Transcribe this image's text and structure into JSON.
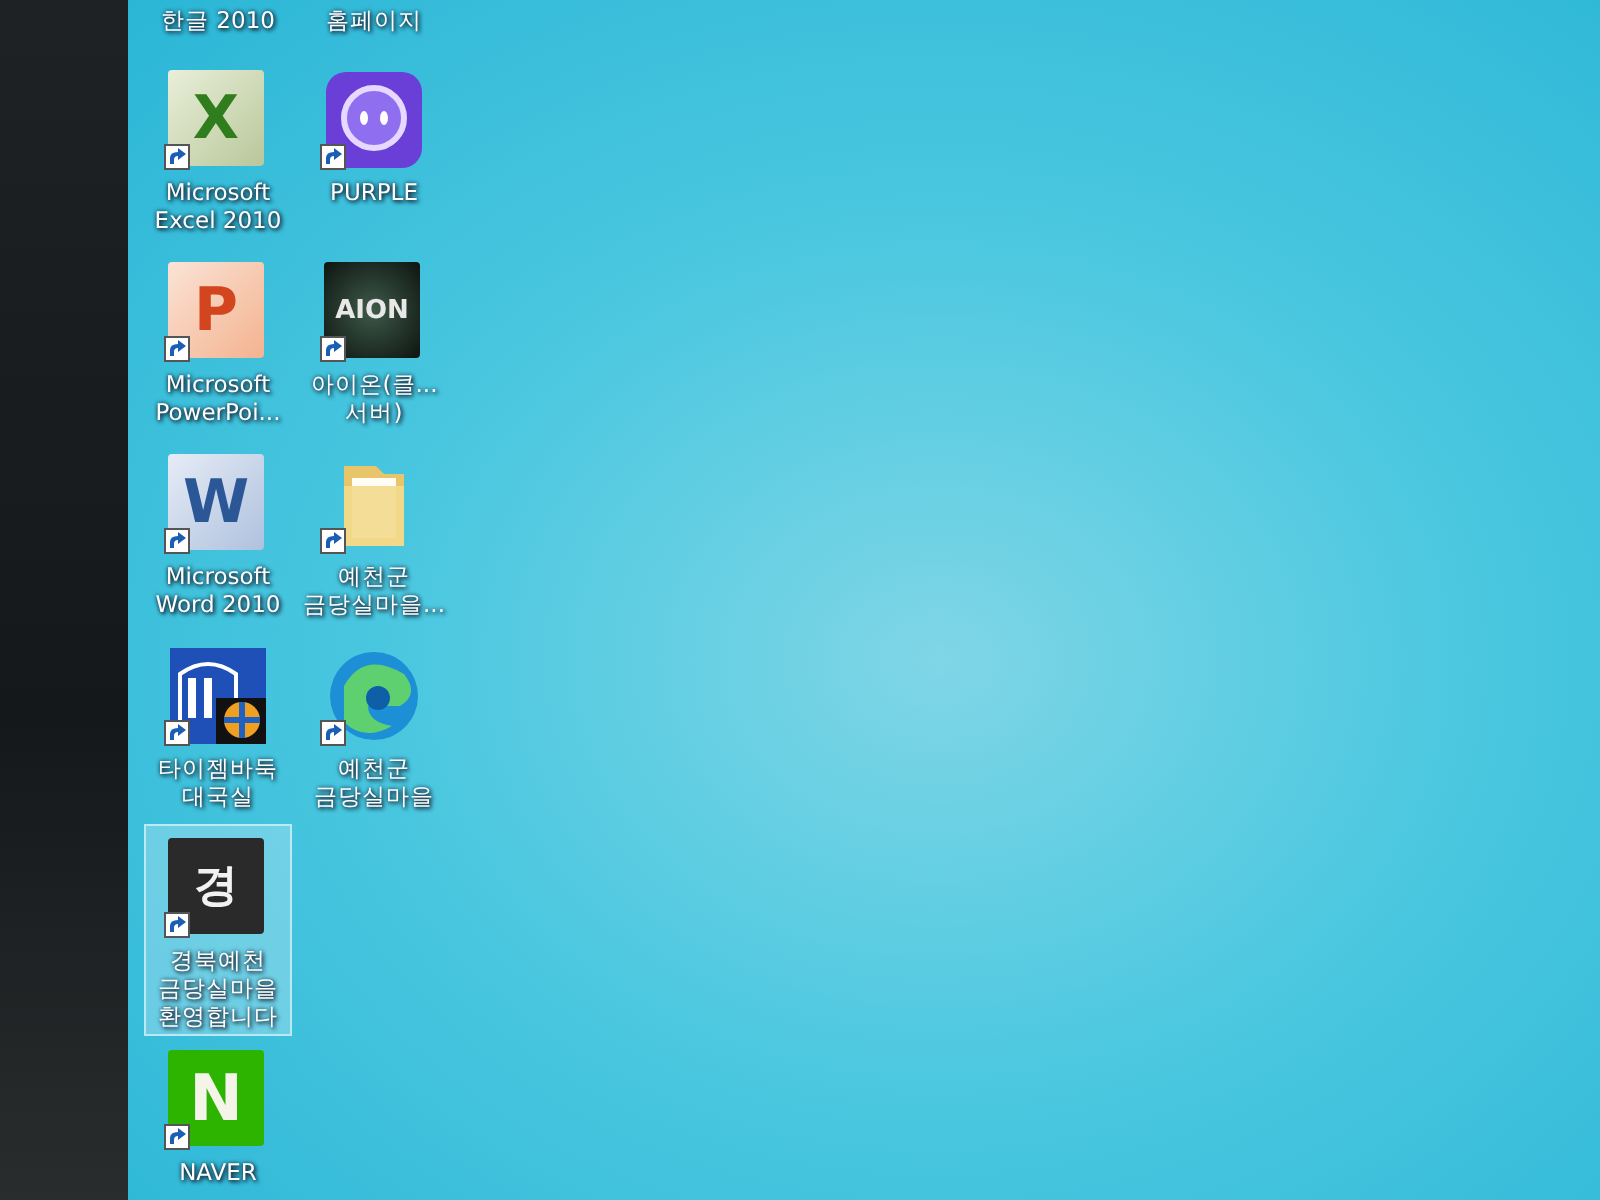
{
  "desktop": {
    "rows": [
      [
        {
          "kind": "cut",
          "label": "한글 2010",
          "selected": false
        },
        {
          "kind": "cut",
          "label": "홈페이지",
          "selected": false
        }
      ],
      [
        {
          "kind": "spreadsheet",
          "glyph": "X",
          "label": "Microsoft\nExcel 2010",
          "selected": false
        },
        {
          "kind": "mascot",
          "label": "PURPLE",
          "selected": false
        }
      ],
      [
        {
          "kind": "slides",
          "glyph": "P",
          "label": "Microsoft\nPowerPoi...",
          "selected": false
        },
        {
          "kind": "game",
          "glyph": "AION",
          "label": "아이온(클...\n서버)",
          "selected": false
        }
      ],
      [
        {
          "kind": "document",
          "glyph": "W",
          "label": "Microsoft\nWord 2010",
          "selected": false
        },
        {
          "kind": "folder",
          "label": "예천군\n금당실마을...",
          "selected": false
        }
      ],
      [
        {
          "kind": "board",
          "label": "타이젬바둑\n대국실",
          "selected": false
        },
        {
          "kind": "browser",
          "label": "예천군\n금당실마을",
          "selected": false
        }
      ],
      [
        {
          "kind": "tile",
          "glyph": "경",
          "label": "경북예천\n금당실마을\n환영합니다",
          "selected": true
        }
      ],
      [
        {
          "kind": "portal",
          "glyph": "N",
          "label": "NAVER",
          "selected": false
        }
      ]
    ]
  }
}
